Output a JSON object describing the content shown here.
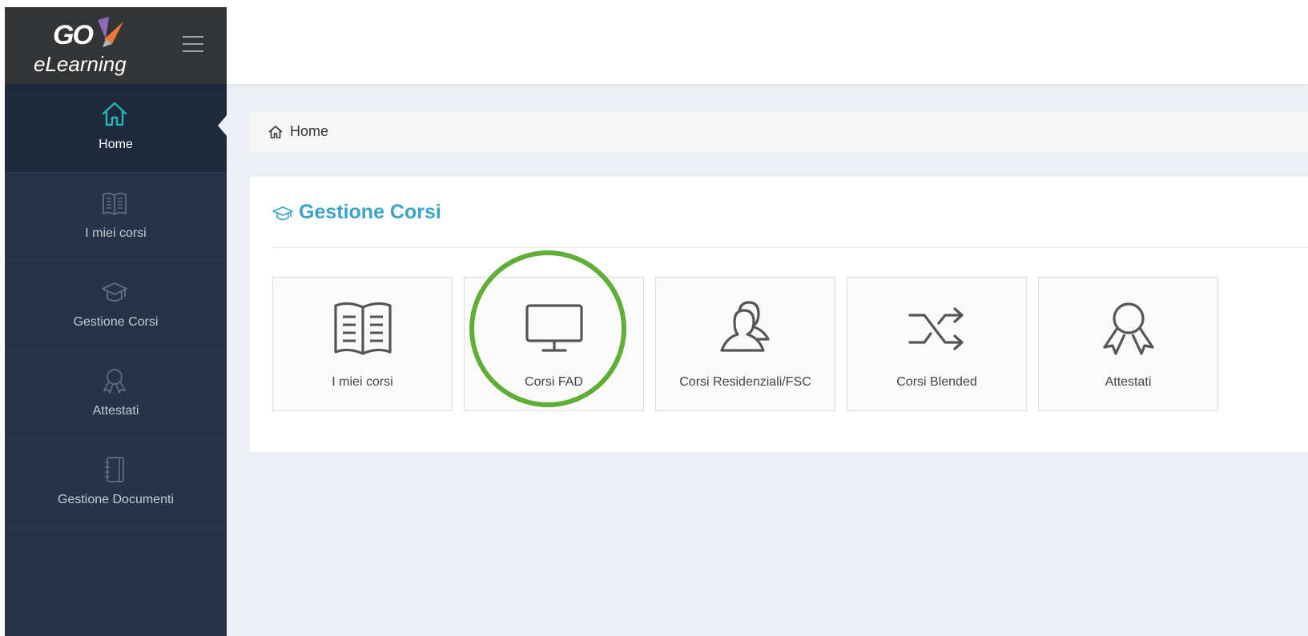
{
  "logo": {
    "mark": "GO",
    "wordmark": "eLearning"
  },
  "sidebar": {
    "items": [
      {
        "label": "Home",
        "icon": "home-icon",
        "active": true
      },
      {
        "label": "I miei corsi",
        "icon": "book-icon"
      },
      {
        "label": "Gestione Corsi",
        "icon": "graduation-cap-icon"
      },
      {
        "label": "Attestati",
        "icon": "award-icon"
      },
      {
        "label": "Gestione Documenti",
        "icon": "notebook-icon"
      }
    ]
  },
  "breadcrumb": {
    "label": "Home",
    "icon": "home-icon"
  },
  "panel": {
    "title": "Gestione Corsi",
    "icon": "graduation-cap-icon",
    "tiles": [
      {
        "label": "I miei corsi",
        "icon": "book-icon"
      },
      {
        "label": "Corsi FAD",
        "icon": "monitor-icon",
        "highlighted": true
      },
      {
        "label": "Corsi Residenziali/FSC",
        "icon": "users-icon"
      },
      {
        "label": "Corsi Blended",
        "icon": "shuffle-icon"
      },
      {
        "label": "Attestati",
        "icon": "award-icon"
      }
    ]
  },
  "colors": {
    "sidebar": "#263348",
    "sidebar_active": "#1d2a3e",
    "accent_teal": "#3aa3c9",
    "home_icon_teal": "#2ab3b5",
    "highlight_green": "#5fae36",
    "background": "#edf0f4"
  }
}
